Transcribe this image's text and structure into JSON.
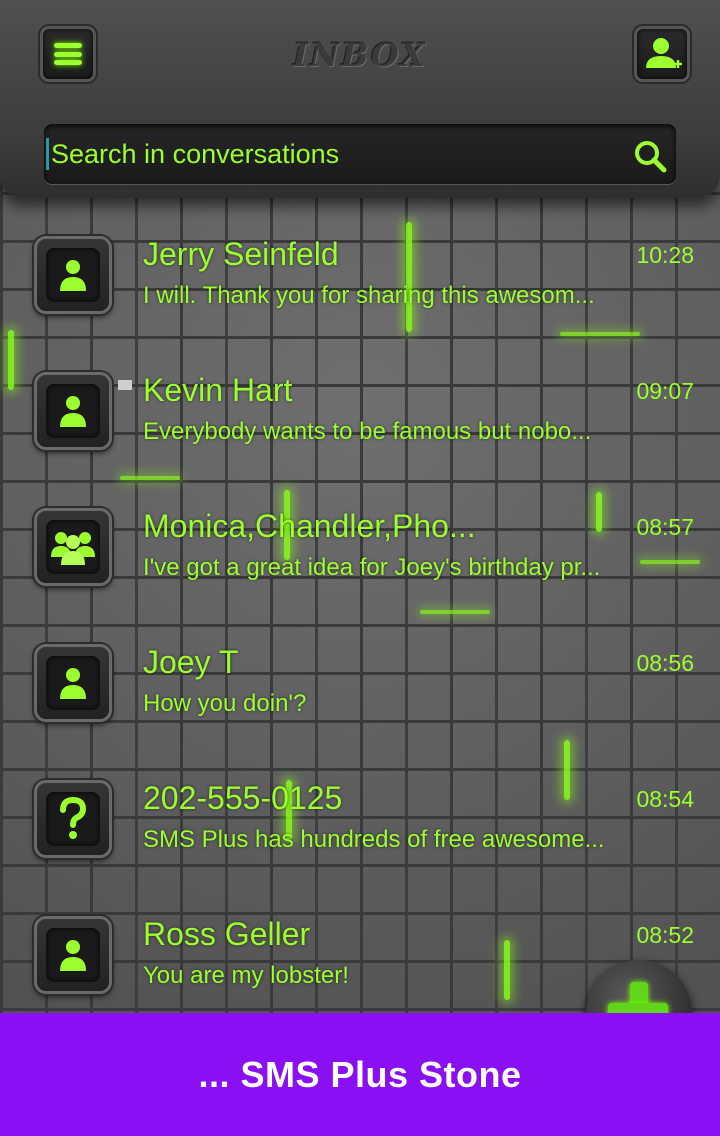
{
  "header": {
    "title": "INBOX",
    "menu_icon": "hamburger-menu-icon",
    "add_contact_icon": "add-contact-icon"
  },
  "search": {
    "placeholder": "Search in conversations",
    "icon": "search-icon"
  },
  "conversations": [
    {
      "name": "Jerry Seinfeld",
      "time": "10:28",
      "snippet": "I will. Thank you for sharing this awesom...",
      "avatar": "person-icon",
      "unread": false
    },
    {
      "name": "Kevin Hart",
      "time": "09:07",
      "snippet": "Everybody wants to be famous but nobo...",
      "avatar": "person-icon",
      "unread": true
    },
    {
      "name": "Monica,Chandler,Pho...",
      "time": "08:57",
      "snippet": "I've got a great idea for Joey's birthday pr...",
      "avatar": "group-icon",
      "unread": false
    },
    {
      "name": "Joey T",
      "time": "08:56",
      "snippet": "How you doin'?",
      "avatar": "person-icon",
      "unread": false
    },
    {
      "name": "202-555-0125",
      "time": "08:54",
      "snippet": "SMS Plus has hundreds of free awesome...",
      "avatar": "unknown-contact-icon",
      "unread": false
    },
    {
      "name": "Ross Geller",
      "time": "08:52",
      "snippet": " You are my lobster!",
      "avatar": "person-icon",
      "unread": false
    }
  ],
  "fab": {
    "icon": "plus-icon"
  },
  "banner": {
    "text": "... SMS Plus Stone"
  },
  "colors": {
    "accent": "#9cff2e",
    "banner": "#8a0ff2"
  }
}
